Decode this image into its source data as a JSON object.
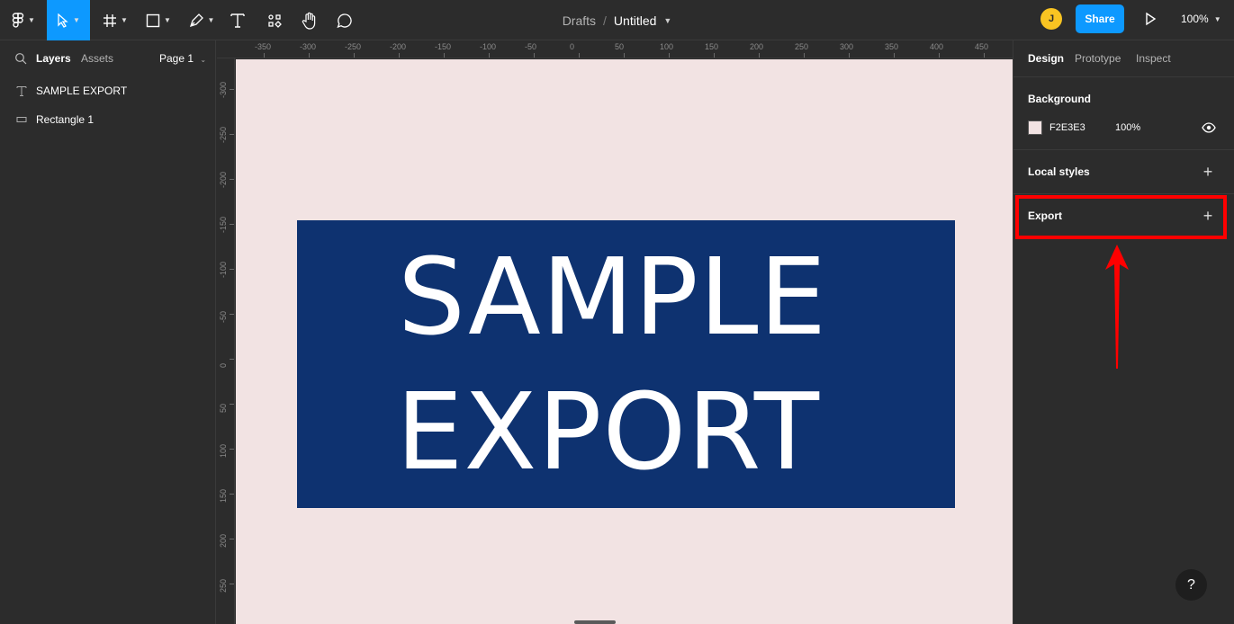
{
  "toolbar": {
    "tools": [
      {
        "name": "figma-menu",
        "icon": "figma-logo-icon"
      },
      {
        "name": "move",
        "icon": "cursor-arrow-icon"
      },
      {
        "name": "frame",
        "icon": "hash-icon"
      },
      {
        "name": "rectangle",
        "icon": "square-icon"
      },
      {
        "name": "pen",
        "icon": "pen-icon"
      },
      {
        "name": "text",
        "icon": "text-t-icon"
      },
      {
        "name": "resources",
        "icon": "components-icon"
      },
      {
        "name": "hand",
        "icon": "hand-icon"
      },
      {
        "name": "comment",
        "icon": "speech-bubble-icon"
      }
    ],
    "breadcrumb": {
      "folder": "Drafts",
      "separator": "/",
      "file": "Untitled"
    },
    "avatar_initial": "J",
    "share_label": "Share",
    "zoom_label": "100%"
  },
  "left_panel": {
    "tabs": {
      "layers": "Layers",
      "assets": "Assets"
    },
    "page_label": "Page 1",
    "layers": [
      {
        "name": "SAMPLE EXPORT",
        "type": "text"
      },
      {
        "name": "Rectangle 1",
        "type": "rectangle"
      }
    ]
  },
  "rulers": {
    "top": [
      "-350",
      "-300",
      "-250",
      "-200",
      "-150",
      "-100",
      "-50",
      "0",
      "50",
      "100",
      "150",
      "200",
      "250",
      "300",
      "350",
      "400",
      "450"
    ],
    "left": [
      "-300",
      "-250",
      "-200",
      "-150",
      "-100",
      "-50",
      "0",
      "50",
      "100",
      "150",
      "200",
      "250"
    ]
  },
  "canvas": {
    "background": "#f2e3e3",
    "artboard_color": "#0e3270",
    "text_line1": "SAMPLE",
    "text_line2": "EXPORT"
  },
  "right_panel": {
    "tabs": {
      "design": "Design",
      "prototype": "Prototype",
      "inspect": "Inspect"
    },
    "background": {
      "title": "Background",
      "hex": "F2E3E3",
      "opacity": "100%"
    },
    "local_styles": {
      "title": "Local styles"
    },
    "export": {
      "title": "Export"
    }
  },
  "help_label": "?",
  "colors": {
    "accent": "#0d99ff",
    "highlight": "#ff0000",
    "avatar": "#f9c422"
  }
}
